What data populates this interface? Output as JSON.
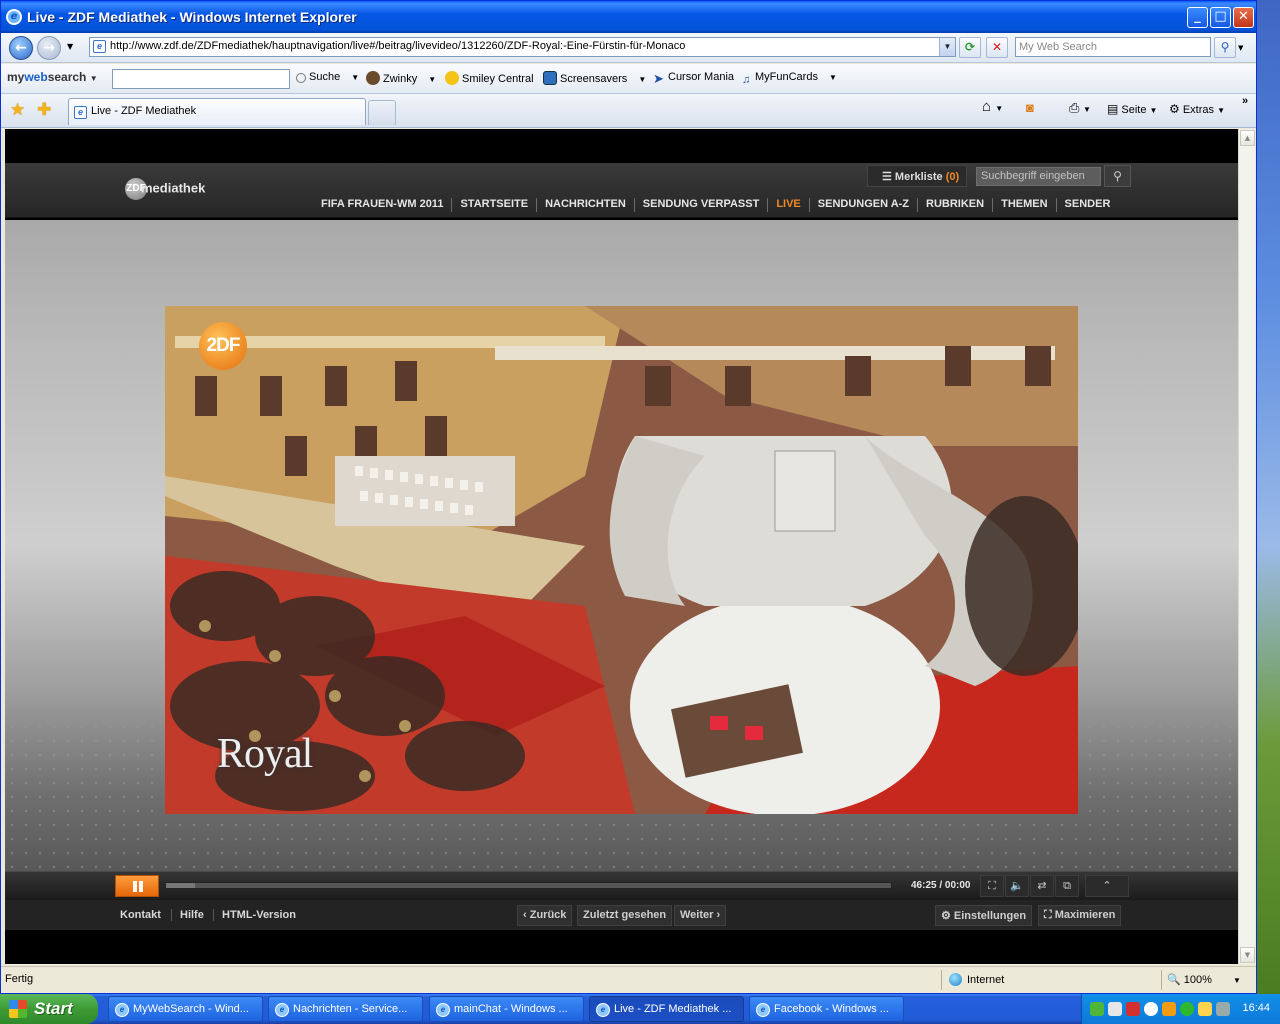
{
  "window": {
    "title": "Live - ZDF Mediathek - Windows Internet Explorer"
  },
  "address": {
    "url": "http://www.zdf.de/ZDFmediathek/hauptnavigation/live#/beitrag/livevideo/1312260/ZDF-Royal:-Eine-Fürstin-für-Monaco",
    "search_placeholder": "My Web Search"
  },
  "toolbar2": {
    "brand_a": "my",
    "brand_b": "web",
    "brand_c": "search",
    "suche": "Suche",
    "zwinky": "Zwinky",
    "smiley": "Smiley Central",
    "screensavers": "Screensavers",
    "cursor": "Cursor Mania",
    "funcards": "MyFunCards"
  },
  "tabs": {
    "active": "Live - ZDF Mediathek"
  },
  "commands": {
    "seite": "Seite",
    "extras": "Extras"
  },
  "zdf": {
    "logo_c": "ZDF",
    "logo_text": "mediathek",
    "merkliste": "Merkliste",
    "merkliste_count": "(0)",
    "search_placeholder": "Suchbegriff eingeben",
    "nav": [
      "FIFA FRAUEN-WM 2011",
      "STARTSEITE",
      "NACHRICHTEN",
      "SENDUNG VERPASST",
      "LIVE",
      "SENDUNGEN A-Z",
      "RUBRIKEN",
      "THEMEN",
      "SENDER"
    ],
    "nav_active_index": 4,
    "video_logo": "2DF",
    "video_caption": "Royal",
    "player": {
      "time": "46:25 / 00:00",
      "progress": 0.04
    },
    "footer_links": [
      "Kontakt",
      "Hilfe",
      "HTML-Version"
    ],
    "footer_buttons": {
      "back": "‹ Zurück",
      "recent": "Zuletzt gesehen",
      "next": "Weiter ›",
      "settings": "⚙ Einstellungen",
      "maximize": "⛶ Maximieren"
    }
  },
  "status": {
    "left": "Fertig",
    "zone": "Internet",
    "zoom": "100%"
  },
  "taskbar": {
    "start": "Start",
    "items": [
      "MyWebSearch - Wind...",
      "Nachrichten - Service...",
      "mainChat - Windows ...",
      "Live - ZDF Mediathek ...",
      "Facebook - Windows ..."
    ],
    "active_index": 3,
    "clock": "16:44"
  },
  "colors": {
    "accent": "#f08a24",
    "xp_blue": "#245edb"
  }
}
